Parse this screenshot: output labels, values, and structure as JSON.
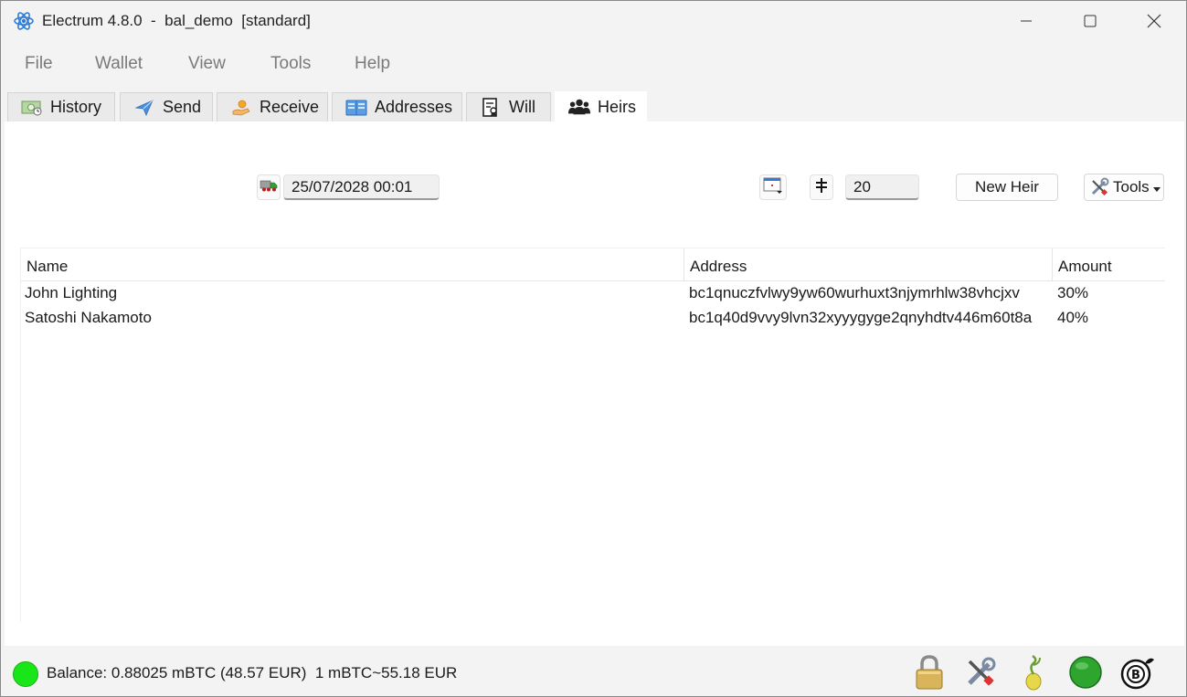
{
  "window": {
    "title": "Electrum 4.8.0  -  bal_demo  [standard]"
  },
  "menu": {
    "items": [
      "File",
      "Wallet",
      "View",
      "Tools",
      "Help"
    ]
  },
  "tabs": [
    {
      "label": "History",
      "icon": "history-icon"
    },
    {
      "label": "Send",
      "icon": "send-icon"
    },
    {
      "label": "Receive",
      "icon": "receive-icon"
    },
    {
      "label": "Addresses",
      "icon": "addresses-icon"
    },
    {
      "label": "Will",
      "icon": "will-icon"
    },
    {
      "label": "Heirs",
      "icon": "heirs-icon",
      "active": true
    }
  ],
  "heirs_toolbar": {
    "date_value": "25/07/2028 00:01",
    "threshold_value": "20",
    "new_heir_label": "New Heir",
    "tools_label": "Tools"
  },
  "table": {
    "columns": [
      "Name",
      "Address",
      "Amount"
    ],
    "rows": [
      {
        "name": "John Lighting",
        "address": "bc1qnuczfvlwy9yw60wurhuxt3njymrhlw38vhcjxv",
        "amount": "30%"
      },
      {
        "name": "Satoshi Nakamoto",
        "address": "bc1q40d9vvy9lvn32xyyygyge2qnyhdtv446m60t8a",
        "amount": "40%"
      }
    ]
  },
  "status": {
    "balance_text": "Balance: 0.88025 mBTC (48.57 EUR)  1 mBTC~55.18 EUR",
    "connection_color": "#19e619"
  },
  "colors": {
    "accent": "#2f7bd6",
    "network_ok": "#2ea52e"
  }
}
